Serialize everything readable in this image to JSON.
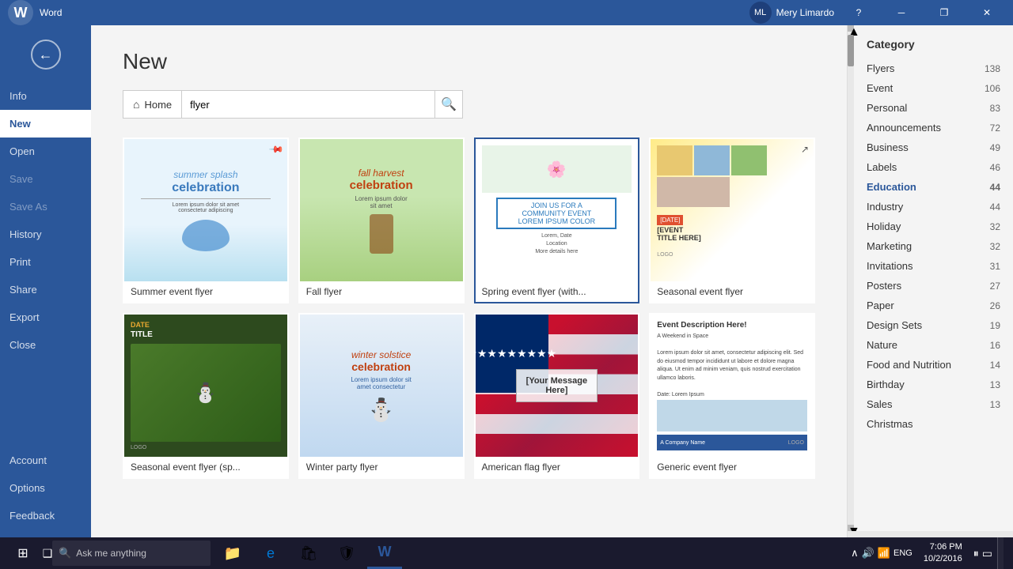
{
  "titlebar": {
    "app_name": "Word",
    "user_name": "Mery Limardo",
    "help_label": "?",
    "minimize_label": "─",
    "restore_label": "❐",
    "close_label": "✕"
  },
  "sidebar": {
    "items": [
      {
        "id": "info",
        "label": "Info"
      },
      {
        "id": "new",
        "label": "New"
      },
      {
        "id": "open",
        "label": "Open"
      },
      {
        "id": "save",
        "label": "Save"
      },
      {
        "id": "save-as",
        "label": "Save As"
      },
      {
        "id": "history",
        "label": "History"
      },
      {
        "id": "print",
        "label": "Print"
      },
      {
        "id": "share",
        "label": "Share"
      },
      {
        "id": "export",
        "label": "Export"
      },
      {
        "id": "close",
        "label": "Close"
      }
    ],
    "bottom_items": [
      {
        "id": "account",
        "label": "Account"
      },
      {
        "id": "options",
        "label": "Options"
      },
      {
        "id": "feedback",
        "label": "Feedback"
      }
    ]
  },
  "page": {
    "title": "New"
  },
  "search": {
    "home_label": "Home",
    "placeholder": "flyer",
    "value": "flyer",
    "search_icon": "🔍"
  },
  "templates": [
    {
      "id": "summer-event",
      "name": "Summer event flyer",
      "type": "summer"
    },
    {
      "id": "fall-flyer",
      "name": "Fall flyer",
      "type": "fall"
    },
    {
      "id": "spring-event",
      "name": "Spring event flyer (with...",
      "type": "spring"
    },
    {
      "id": "seasonal-event",
      "name": "Seasonal event flyer",
      "type": "seasonal"
    },
    {
      "id": "seasonal-sp",
      "name": "Seasonal event flyer (sp...",
      "type": "seasonal2"
    },
    {
      "id": "winter-party",
      "name": "Winter party flyer",
      "type": "winter"
    },
    {
      "id": "american-flag",
      "name": "American flag flyer",
      "type": "american"
    },
    {
      "id": "generic-event",
      "name": "Generic event flyer",
      "type": "generic"
    }
  ],
  "categories": {
    "header": "Category",
    "items": [
      {
        "name": "Flyers",
        "count": 138
      },
      {
        "name": "Event",
        "count": 106
      },
      {
        "name": "Personal",
        "count": 83
      },
      {
        "name": "Announcements",
        "count": 72
      },
      {
        "name": "Business",
        "count": 49
      },
      {
        "name": "Labels",
        "count": 46
      },
      {
        "name": "Education",
        "count": 44,
        "highlighted": true
      },
      {
        "name": "Industry",
        "count": 44
      },
      {
        "name": "Holiday",
        "count": 32
      },
      {
        "name": "Marketing",
        "count": 32
      },
      {
        "name": "Invitations",
        "count": 31
      },
      {
        "name": "Posters",
        "count": 27
      },
      {
        "name": "Paper",
        "count": 26
      },
      {
        "name": "Design Sets",
        "count": 19
      },
      {
        "name": "Nature",
        "count": 16
      },
      {
        "name": "Food and Nutrition",
        "count": 14
      },
      {
        "name": "Birthday",
        "count": 13
      },
      {
        "name": "Sales",
        "count": 13
      },
      {
        "name": "Christmas",
        "count": ""
      }
    ]
  },
  "taskbar": {
    "search_placeholder": "Ask me anything",
    "time": "7:06 PM",
    "date": "10/2/2016",
    "lang": "ENG"
  }
}
